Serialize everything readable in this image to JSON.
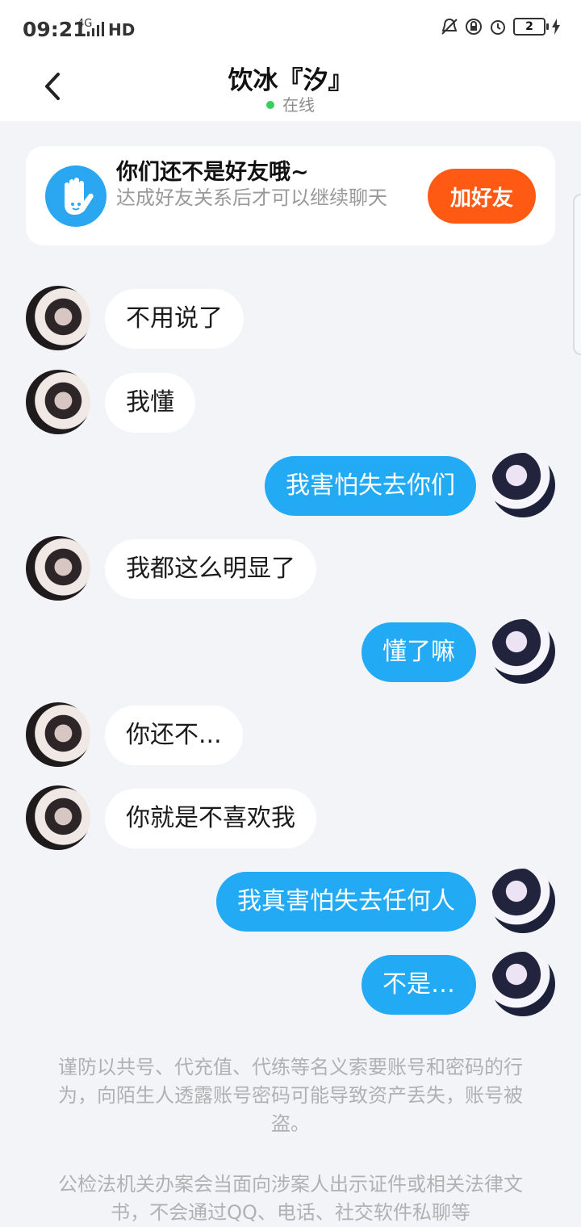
{
  "status_bar": {
    "time": "09:21",
    "network": "4G",
    "hd": "HD",
    "battery": "2"
  },
  "header": {
    "title": "饮冰『汐』",
    "presence": "在线"
  },
  "friend_card": {
    "title": "你们还不是好友哦~",
    "subtitle": "达成好友关系后才可以继续聊天",
    "button": "加好友"
  },
  "messages": [
    {
      "direction": "in",
      "text": "不用说了"
    },
    {
      "direction": "in",
      "text": "我懂"
    },
    {
      "direction": "out",
      "text": "我害怕失去你们"
    },
    {
      "direction": "in",
      "text": "我都这么明显了"
    },
    {
      "direction": "out",
      "text": "懂了嘛"
    },
    {
      "direction": "in",
      "text": "你还不..."
    },
    {
      "direction": "in",
      "text": "你就是不喜欢我"
    },
    {
      "direction": "out",
      "text": "我真害怕失去任何人"
    },
    {
      "direction": "out",
      "text": "不是…"
    }
  ],
  "notices": [
    "谨防以共号、代充值、代练等名义索要账号和密码的行为，向陌生人透露账号密码可能导致资产丢失，账号被盗。",
    "公检法机关办案会当面向涉案人出示证件或相关法律文书，不会通过QQ、电话、社交软件私聊等"
  ],
  "colors": {
    "accent_blue": "#22aaf5",
    "add_button": "#ff5a14",
    "online_dot": "#32d15d"
  }
}
